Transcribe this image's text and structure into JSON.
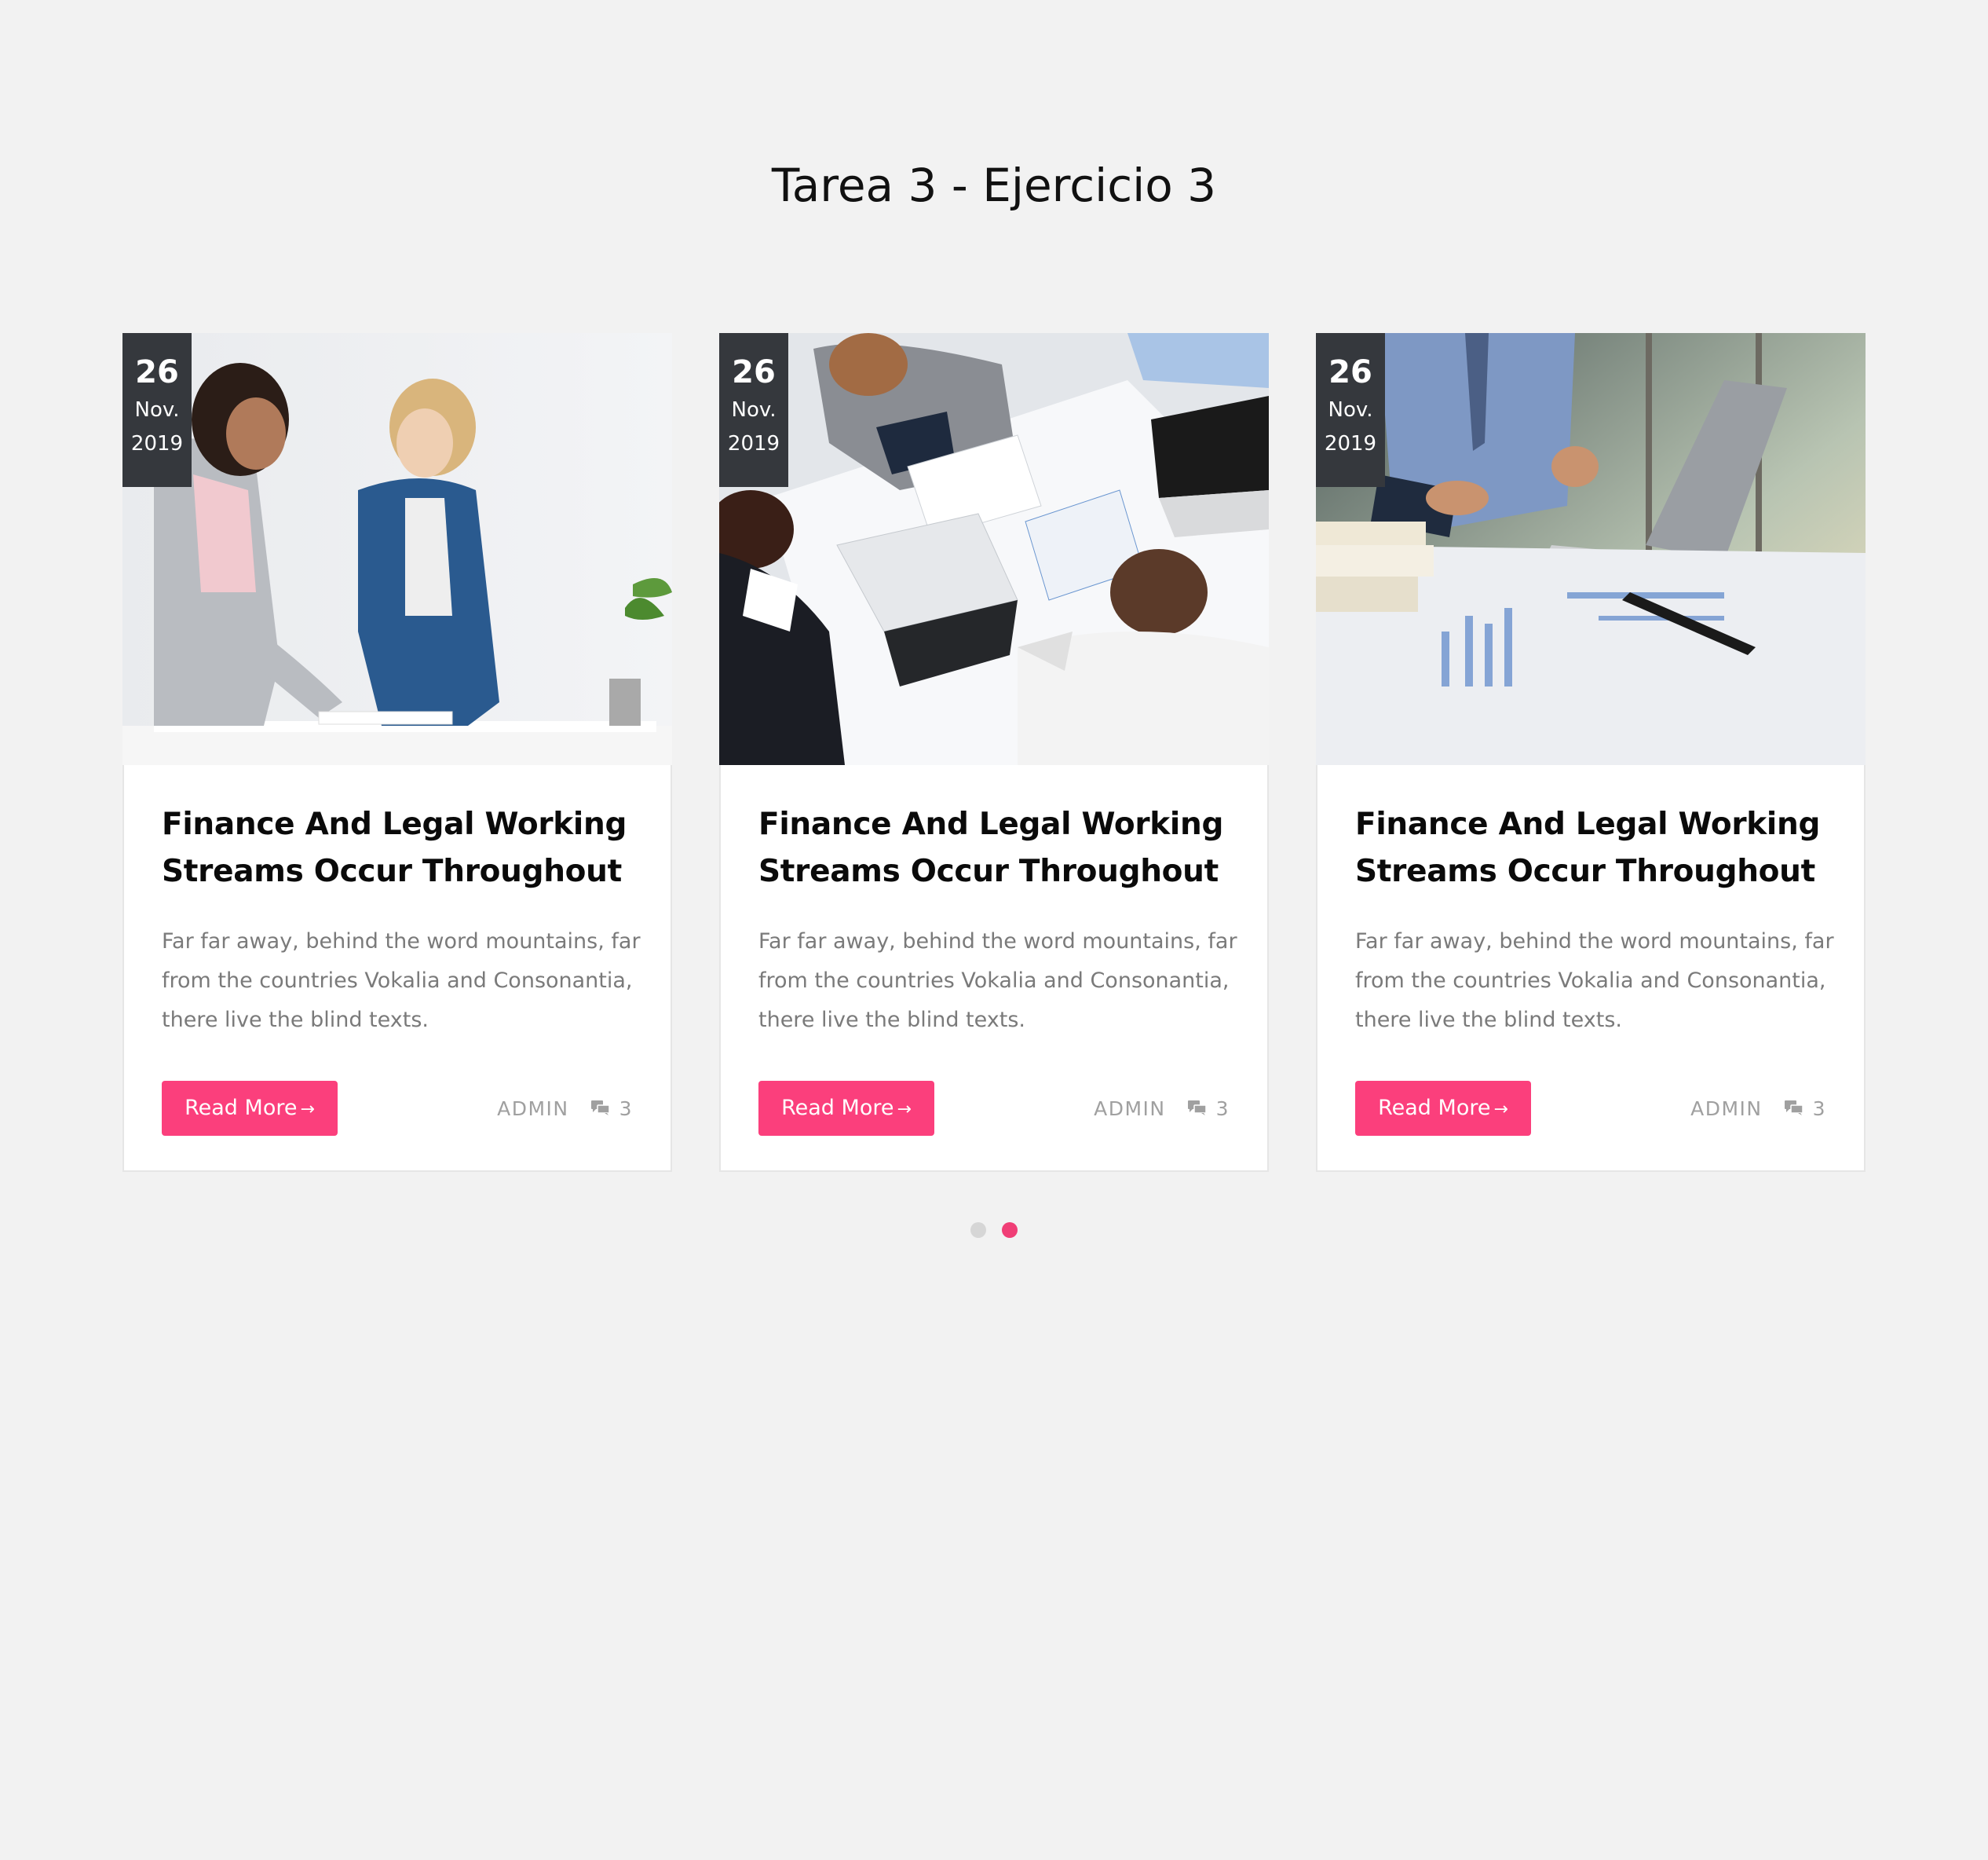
{
  "page": {
    "title": "Tarea 3 - Ejercicio 3"
  },
  "colors": {
    "background": "#f2f2f2",
    "accent": "#fb3f7c",
    "badge": "#35383d"
  },
  "posts": [
    {
      "date": {
        "day": "26",
        "month": "Nov.",
        "year": "2019"
      },
      "image": "women-working-at-desk-photo",
      "title": "Finance And Legal Working Streams Occur Throughout",
      "excerpt": "Far far away, behind the word mountains, far from the countries Vokalia and Consonantia, there live the blind texts.",
      "button_label": "Read More",
      "author": "ADMIN",
      "comments": "3"
    },
    {
      "date": {
        "day": "26",
        "month": "Nov.",
        "year": "2019"
      },
      "image": "team-meeting-overhead-photo",
      "title": "Finance And Legal Working Streams Occur Throughout",
      "excerpt": "Far far away, behind the word mountains, far from the countries Vokalia and Consonantia, there live the blind texts.",
      "button_label": "Read More",
      "author": "ADMIN",
      "comments": "3"
    },
    {
      "date": {
        "day": "26",
        "month": "Nov.",
        "year": "2019"
      },
      "image": "business-laptop-charts-photo",
      "title": "Finance And Legal Working Streams Occur Throughout",
      "excerpt": "Far far away, behind the word mountains, far from the countries Vokalia and Consonantia, there live the blind texts.",
      "button_label": "Read More",
      "author": "ADMIN",
      "comments": "3"
    }
  ],
  "carousel": {
    "pages": 2,
    "active": 2
  }
}
